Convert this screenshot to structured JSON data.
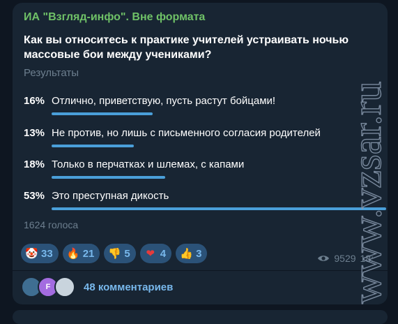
{
  "post": {
    "channel": "ИА \"Взгляд-инфо\". Вне формата",
    "question": "Как вы относитесь к практике учителей устраивать ночью массовые бои между учениками?",
    "results_label": "Результаты",
    "options": [
      {
        "percent": "16%",
        "text": "Отлично, приветствую, пусть растут бойцами!",
        "share": 0.16
      },
      {
        "percent": "13%",
        "text": "Не против, но лишь с письменного согласия родителей",
        "share": 0.13
      },
      {
        "percent": "18%",
        "text": "Только в перчатках и шлемах, с капами",
        "share": 0.18
      },
      {
        "percent": "53%",
        "text": "Это преступная дикость",
        "share": 0.53
      }
    ],
    "votes": "1624 голоса",
    "reactions": [
      {
        "emoji": "🤡",
        "icon": "clown-icon",
        "count": "33"
      },
      {
        "emoji": "🔥",
        "icon": "fire-icon",
        "count": "21"
      },
      {
        "emoji": "👎",
        "icon": "thumbs-down-icon",
        "count": "5"
      },
      {
        "emoji": "❤",
        "icon": "heart-icon",
        "count": "4"
      },
      {
        "emoji": "👍",
        "icon": "thumbs-up-icon",
        "count": "3"
      }
    ],
    "views": "9529",
    "time": "18:",
    "comments": {
      "avatar_letter": "F",
      "label": "48 комментариев"
    }
  },
  "watermark": "www.vzsar.ru",
  "colors": {
    "background": "#0e1621",
    "bubble": "#182533",
    "accent": "#4a9fd9",
    "channel_name": "#6fc167",
    "muted": "#6d7f8f",
    "reaction_bg": "#2b5278"
  }
}
